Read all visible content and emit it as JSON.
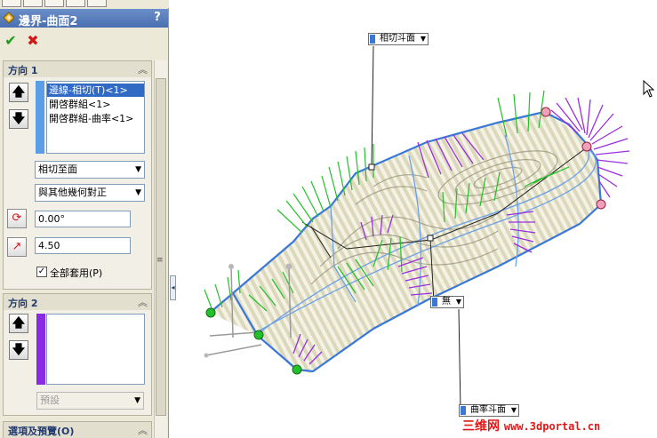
{
  "panel": {
    "title": "邊界-曲面2",
    "help_label": "?",
    "ok_label": "✔",
    "cancel_label": "✖",
    "direction1": {
      "header": "方向 1",
      "items": [
        "邊線-相切(T)<1>",
        "開啓群組<1>",
        "開啓群組-曲率<1>"
      ],
      "tangency_type": "相切至面",
      "alignment": "與其他幾何對正",
      "angle_value": "0.00°",
      "tangent_length": "4.50",
      "apply_all_label": "全部套用(P)",
      "apply_all_checked": true
    },
    "direction2": {
      "header": "方向 2",
      "items": [],
      "tangency_type": "預設"
    },
    "options_header": "選項及預覽(O)"
  },
  "viewport": {
    "callout_top": "相切斗面",
    "callout_middle": "無",
    "callout_bottom": "曲率斗面"
  },
  "watermark": {
    "brand": "三维网",
    "url": "www.3dportal.cn"
  },
  "colors": {
    "title_bar": "#4a6fb0",
    "selection": "#316ac5",
    "direction1_color": "#5b9ee6",
    "direction2_color": "#8a2be2",
    "ok": "#1a9a1a",
    "cancel": "#d01818",
    "watermark": "#e01818"
  }
}
